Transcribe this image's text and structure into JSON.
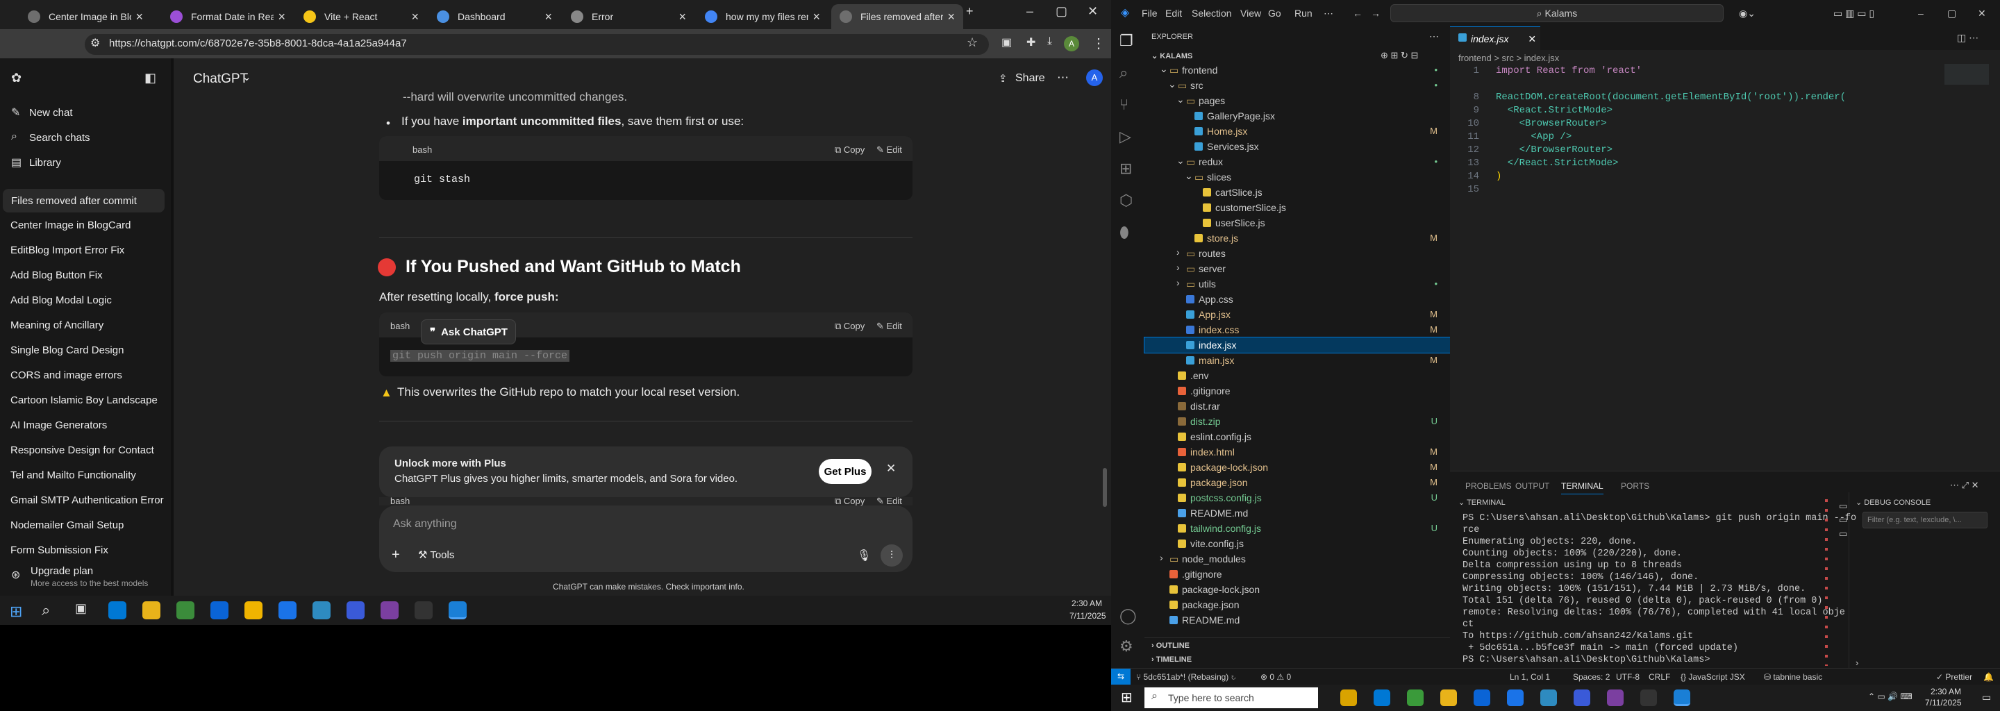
{
  "browser": {
    "tabs": [
      {
        "label": "Center Image in BlogC",
        "color": "#6e6e6e"
      },
      {
        "label": "Format Date in React C",
        "color": "#9b4fd6"
      },
      {
        "label": "Vite + React",
        "color": "#f5c518"
      },
      {
        "label": "Dashboard",
        "color": "#4a90e2"
      },
      {
        "label": "Error",
        "color": "#888888"
      },
      {
        "label": "how my my files remo",
        "color": "#4285f4"
      },
      {
        "label": "Files removed after co",
        "color": "#6e6e6e"
      }
    ],
    "url": "https://chatgpt.com/c/68702e7e-35b8-8001-8dca-4a1a25a944a7",
    "profile": "A"
  },
  "sidebar": {
    "top": [
      "New chat",
      "Search chats",
      "Library"
    ],
    "chats": [
      "Files removed after commit",
      "Center Image in BlogCard",
      "EditBlog Import Error Fix",
      "Add Blog Button Fix",
      "Add Blog Modal Logic",
      "Meaning of Ancillary",
      "Single Blog Card Design",
      "CORS and image errors",
      "Cartoon Islamic Boy Landscape",
      "AI Image Generators",
      "Responsive Design for Contact",
      "Tel and Mailto Functionality",
      "Gmail SMTP Authentication Error",
      "Nodemailer Gmail Setup",
      "Form Submission Fix"
    ],
    "upgrade_title": "Upgrade plan",
    "upgrade_sub": "More access to the best models"
  },
  "main": {
    "model": "ChatGPT",
    "share": "Share",
    "frag_top": "--hard will overwrite uncommitted changes.",
    "bullet_pre": "If you have ",
    "bullet_bold": "important uncommitted files",
    "bullet_post": ", save them first or use:",
    "code1_lang": "bash",
    "code1": "git stash",
    "copy": "Copy",
    "edit": "Edit",
    "heading": "If You Pushed and Want GitHub to Match",
    "after_pre": "After resetting locally, ",
    "after_bold": "force push:",
    "code2_lang": "bash",
    "code2": "git push origin main --force",
    "ask": "Ask ChatGPT",
    "warn": "This overwrites the GitHub repo to match your local reset version.",
    "code3_lang": "bash",
    "plus_title": "Unlock more with Plus",
    "plus_desc": "ChatGPT Plus gives you higher limits, smarter models, and Sora for video.",
    "get_plus": "Get Plus",
    "composer_placeholder": "Ask anything",
    "tools": "Tools",
    "disclaimer": "ChatGPT can make mistakes. Check important info."
  },
  "left_clock": {
    "time": "2:30 AM",
    "date": "7/11/2025"
  },
  "vscode": {
    "menu": [
      "File",
      "Edit",
      "Selection",
      "View",
      "Go",
      "Run"
    ],
    "search": "Kalams",
    "explorer_title": "EXPLORER",
    "root": "KALAMS",
    "tree": [
      {
        "name": "frontend",
        "type": "folder",
        "indent": 1,
        "open": true,
        "badge": "•"
      },
      {
        "name": "src",
        "type": "folder",
        "indent": 2,
        "open": true,
        "badge": "•"
      },
      {
        "name": "pages",
        "type": "folder",
        "indent": 3,
        "open": true,
        "badge": ""
      },
      {
        "name": "GalleryPage.jsx",
        "type": "jsx",
        "indent": 4,
        "badge": ""
      },
      {
        "name": "Home.jsx",
        "type": "jsx",
        "indent": 4,
        "badge": "M"
      },
      {
        "name": "Services.jsx",
        "type": "jsx",
        "indent": 4,
        "badge": ""
      },
      {
        "name": "redux",
        "type": "folder",
        "indent": 3,
        "open": true,
        "badge": "•"
      },
      {
        "name": "slices",
        "type": "folder",
        "indent": 4,
        "open": true,
        "badge": ""
      },
      {
        "name": "cartSlice.js",
        "type": "js",
        "indent": 5,
        "badge": ""
      },
      {
        "name": "customerSlice.js",
        "type": "js",
        "indent": 5,
        "badge": ""
      },
      {
        "name": "userSlice.js",
        "type": "js",
        "indent": 5,
        "badge": ""
      },
      {
        "name": "store.js",
        "type": "js",
        "indent": 4,
        "badge": "M"
      },
      {
        "name": "routes",
        "type": "folder",
        "indent": 3,
        "open": false,
        "badge": ""
      },
      {
        "name": "server",
        "type": "folder",
        "indent": 3,
        "open": false,
        "badge": ""
      },
      {
        "name": "utils",
        "type": "folder",
        "indent": 3,
        "open": false,
        "badge": "•"
      },
      {
        "name": "App.css",
        "type": "css",
        "indent": 3,
        "badge": ""
      },
      {
        "name": "App.jsx",
        "type": "jsx",
        "indent": 3,
        "badge": "M"
      },
      {
        "name": "index.css",
        "type": "css",
        "indent": 3,
        "badge": "M"
      },
      {
        "name": "index.jsx",
        "type": "jsx",
        "indent": 3,
        "badge": "",
        "selected": true
      },
      {
        "name": "main.jsx",
        "type": "jsx",
        "indent": 3,
        "badge": "M"
      },
      {
        "name": ".env",
        "type": "env",
        "indent": 2,
        "badge": ""
      },
      {
        "name": ".gitignore",
        "type": "git",
        "indent": 2,
        "badge": ""
      },
      {
        "name": "dist.rar",
        "type": "rar",
        "indent": 2,
        "badge": ""
      },
      {
        "name": "dist.zip",
        "type": "zip",
        "indent": 2,
        "badge": "U"
      },
      {
        "name": "eslint.config.js",
        "type": "js",
        "indent": 2,
        "badge": ""
      },
      {
        "name": "index.html",
        "type": "html",
        "indent": 2,
        "badge": "M"
      },
      {
        "name": "package-lock.json",
        "type": "json",
        "indent": 2,
        "badge": "M"
      },
      {
        "name": "package.json",
        "type": "json",
        "indent": 2,
        "badge": "M"
      },
      {
        "name": "postcss.config.js",
        "type": "js",
        "indent": 2,
        "badge": "U"
      },
      {
        "name": "README.md",
        "type": "md",
        "indent": 2,
        "badge": ""
      },
      {
        "name": "tailwind.config.js",
        "type": "js",
        "indent": 2,
        "badge": "U"
      },
      {
        "name": "vite.config.js",
        "type": "js",
        "indent": 2,
        "badge": ""
      },
      {
        "name": "node_modules",
        "type": "folder",
        "indent": 1,
        "open": false,
        "badge": ""
      },
      {
        "name": ".gitignore",
        "type": "git",
        "indent": 1,
        "badge": ""
      },
      {
        "name": "package-lock.json",
        "type": "json",
        "indent": 1,
        "badge": ""
      },
      {
        "name": "package.json",
        "type": "json",
        "indent": 1,
        "badge": ""
      },
      {
        "name": "README.md",
        "type": "md",
        "indent": 1,
        "badge": ""
      }
    ],
    "outline": "OUTLINE",
    "timeline": "TIMELINE",
    "tab": "index.jsx",
    "breadcrumb": "frontend > src > index.jsx",
    "code": [
      {
        "n": "1",
        "t": "import React from 'react'"
      },
      {
        "n": "8",
        "t": "ReactDOM.createRoot(document.getElementById('root')).render("
      },
      {
        "n": "9",
        "t": "  <React.StrictMode>"
      },
      {
        "n": "10",
        "t": "    <BrowserRouter>"
      },
      {
        "n": "11",
        "t": "      <App />"
      },
      {
        "n": "12",
        "t": "    </BrowserRouter>"
      },
      {
        "n": "13",
        "t": "  </React.StrictMode>"
      },
      {
        "n": "14",
        "t": ")"
      },
      {
        "n": "15",
        "t": ""
      }
    ],
    "panel_tabs": [
      "PROBLEMS",
      "OUTPUT",
      "TERMINAL",
      "PORTS"
    ],
    "terminal_title": "TERMINAL",
    "debug_title": "DEBUG CONSOLE",
    "debug_filter": "Filter (e.g. text, !exclude, \\...",
    "terminal": [
      "PS C:\\Users\\ahsan.ali\\Desktop\\Github\\Kalams> git push origin main --fo",
      "rce",
      "Enumerating objects: 220, done.",
      "Counting objects: 100% (220/220), done.",
      "Delta compression using up to 8 threads",
      "Compressing objects: 100% (146/146), done.",
      "Writing objects: 100% (151/151), 7.44 MiB | 2.73 MiB/s, done.",
      "Total 151 (delta 76), reused 0 (delta 0), pack-reused 0 (from 0)",
      "remote: Resolving deltas: 100% (76/76), completed with 41 local obje",
      "ct",
      "To https://github.com/ahsan242/Kalams.git",
      " + 5dc651a...b5fce3f main -> main (forced update)",
      "PS C:\\Users\\ahsan.ali\\Desktop\\Github\\Kalams> "
    ],
    "status": {
      "branch": "5dc651ab*! (Rebasing)",
      "errors": "⊗ 0 ⚠ 0",
      "position": "Ln 1, Col 1",
      "spaces": "Spaces: 2",
      "encoding": "UTF-8",
      "eol": "CRLF",
      "lang": "{} JavaScript JSX",
      "tabnine": "tabnine basic",
      "prettier": "✓ Prettier"
    }
  },
  "win_taskbar": {
    "search": "Type here to search",
    "time": "2:30 AM",
    "date": "7/11/2025"
  }
}
